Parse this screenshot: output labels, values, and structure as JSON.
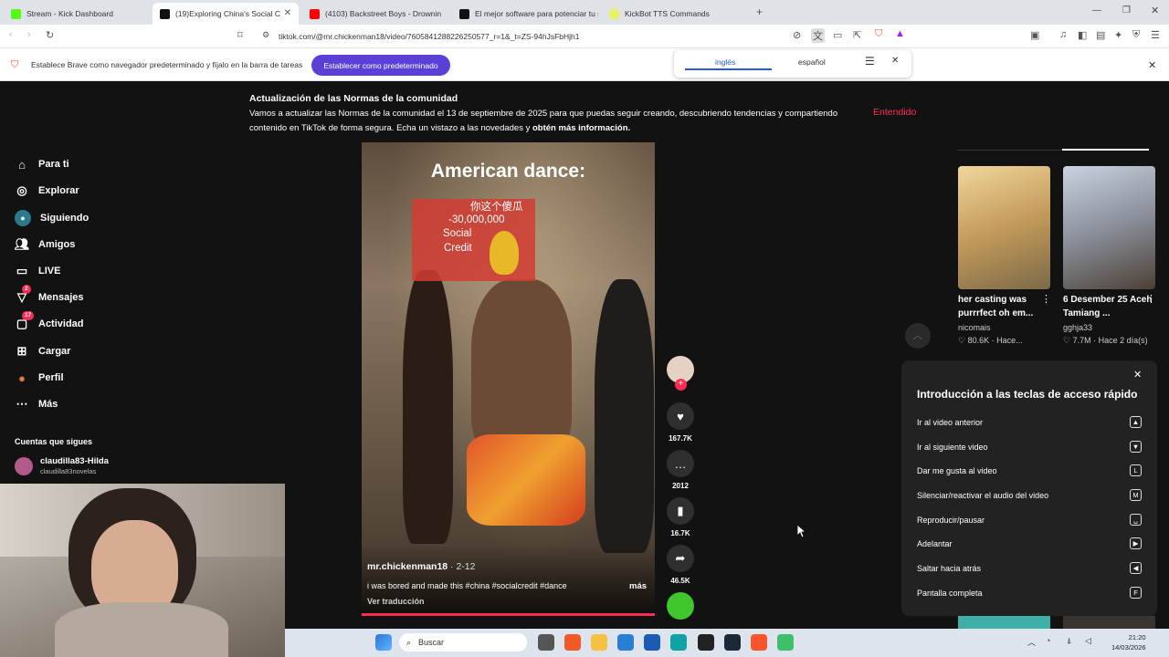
{
  "browser": {
    "tabs": [
      {
        "title": "Stream - Kick Dashboard",
        "color": "#53fc18"
      },
      {
        "title": "(19)Exploring China's Social C",
        "color": "#111111"
      },
      {
        "title": "(4103) Backstreet Boys - Drownin",
        "color": "#ff0000"
      },
      {
        "title": "El mejor software para potenciar tu st",
        "color": "#111111"
      },
      {
        "title": "KickBot TTS Commands",
        "color": "#e5f36a"
      }
    ],
    "url": "tiktok.com/@mr.chickenman18/video/7605841288226250577_r=1&_t=ZS-94hJsFbHjh1",
    "infobar_text": "Establece Brave como navegador predeterminado y fíjalo en la barra de tareas",
    "infobar_button": "Establecer como predeterminado",
    "translate": {
      "from": "inglés",
      "to": "español"
    }
  },
  "notice": {
    "title": "Actualización de las Normas de la comunidad",
    "body": "Vamos a actualizar las Normas de la comunidad el 13 de septiembre de 2025 para que puedas seguir creando, descubriendo tendencias y compartiendo contenido en TikTok de forma segura. Echa un vistazo a las novedades y ",
    "link": "obtén más información.",
    "dismiss": "Entendido"
  },
  "sidebar": {
    "items": [
      {
        "label": "Para ti",
        "icon": "home-icon"
      },
      {
        "label": "Explorar",
        "icon": "compass-icon"
      },
      {
        "label": "Siguiendo",
        "icon": "following-icon"
      },
      {
        "label": "Amigos",
        "icon": "friends-icon"
      },
      {
        "label": "LIVE",
        "icon": "live-icon"
      },
      {
        "label": "Mensajes",
        "icon": "messages-icon",
        "badge": "2"
      },
      {
        "label": "Actividad",
        "icon": "activity-icon",
        "badge": "17"
      },
      {
        "label": "Cargar",
        "icon": "upload-icon"
      },
      {
        "label": "Perfil",
        "icon": "profile-icon"
      },
      {
        "label": "Más",
        "icon": "more-icon"
      }
    ],
    "following_header": "Cuentas que sigues",
    "following": [
      {
        "name": "claudilla83-Hilda",
        "handle": "claudilla83novelas"
      }
    ]
  },
  "video": {
    "overlay_title": "American dance:",
    "sticker_lines": [
      "你这个傻瓜",
      "-30,000,000",
      "Social",
      "Credit"
    ],
    "author": "mr.chickenman18",
    "date": " · 2-12",
    "caption": "i was bored and made this #china #socialcredit #dance",
    "more": "más",
    "translate": "Ver traducción"
  },
  "actions": [
    {
      "name": "like",
      "count": "167.7K"
    },
    {
      "name": "comment",
      "count": "2012"
    },
    {
      "name": "bookmark",
      "count": "16.7K"
    },
    {
      "name": "share",
      "count": "46.5K"
    }
  ],
  "related": [
    {
      "caption": "her casting was purrrfect oh em...",
      "author": "nicomais",
      "meta": "♡ 80.6K · Hace..."
    },
    {
      "caption": "6 Desember 25 Aceh Tamiang ...",
      "author": "gghja33",
      "meta": "♡ 7.7M · Hace 2 día(s)"
    }
  ],
  "shortcuts": {
    "title": "Introducción a las teclas de acceso rápido",
    "items": [
      {
        "label": "Ir al video anterior",
        "key": "▲"
      },
      {
        "label": "Ir al siguiente video",
        "key": "▼"
      },
      {
        "label": "Dar me gusta al video",
        "key": "L"
      },
      {
        "label": "Silenciar/reactivar el audio del video",
        "key": "M"
      },
      {
        "label": "Reproducir/pausar",
        "key": "␣"
      },
      {
        "label": "Adelantar",
        "key": "▶"
      },
      {
        "label": "Saltar hacia atrás",
        "key": "◀"
      },
      {
        "label": "Pantalla completa",
        "key": "F"
      }
    ]
  },
  "taskbar": {
    "search": "Buscar",
    "time": "21:20",
    "date": "14/03/2026"
  }
}
